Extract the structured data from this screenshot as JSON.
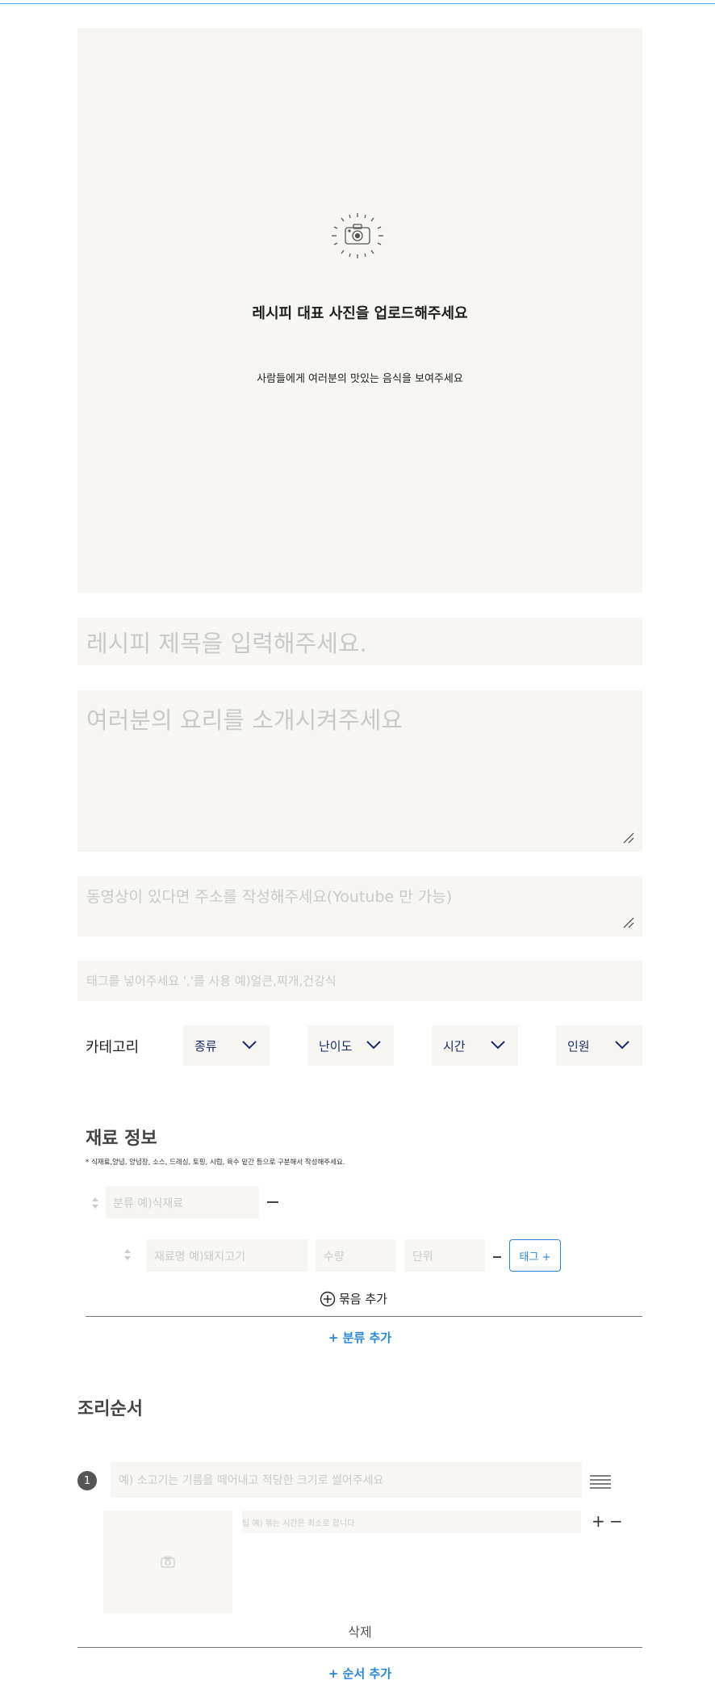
{
  "photo_upload": {
    "icon": "camera-icon",
    "title": "레시피 대표 사진을 업로드해주세요",
    "subtitle": "사람들에게 여러분의 맛있는 음식을 보여주세요"
  },
  "fields": {
    "title_placeholder": "레시피 제목을 입력해주세요.",
    "intro_placeholder": "여러분의 요리를 소개시켜주세요",
    "video_placeholder": "동영상이 있다면 주소를 작성해주세요(Youtube 만 가능)",
    "tags_placeholder": "태그를 넣어주세요 ','를 사용 예)얼큰,찌개,건강식"
  },
  "category": {
    "label": "카테고리",
    "selects": [
      "종류",
      "난이도",
      "시간",
      "인원"
    ]
  },
  "ingredients": {
    "title": "재료 정보",
    "note": "* 식재료,양념, 양념장, 소스, 드레싱, 토핑, 시럽, 육수 밑간 등으로 구분해서 작성해주세요.",
    "group_placeholder": "분류 예)식재료",
    "name_placeholder": "재료명 예)돼지고기",
    "qty_placeholder": "수량",
    "unit_placeholder": "단위",
    "tag_button": "태그 +",
    "bundle_add": "묶음 추가",
    "class_add": "+ 분류 추가"
  },
  "steps": {
    "title": "조리순서",
    "items": [
      {
        "number": "1",
        "placeholder": "예) 소고기는 기름을 떼어내고 적당한 크기로 썰어주세요",
        "tip_placeholder": "팁 예) 볶는 시간은 최소로 합니다",
        "plus": "+",
        "minus": "−"
      }
    ],
    "delete": "삭제",
    "add": "+ 순서 추가"
  },
  "colors": {
    "accent": "#2a86d9",
    "field_bg": "#f7f6f3",
    "select_text": "#1a2b6b"
  }
}
